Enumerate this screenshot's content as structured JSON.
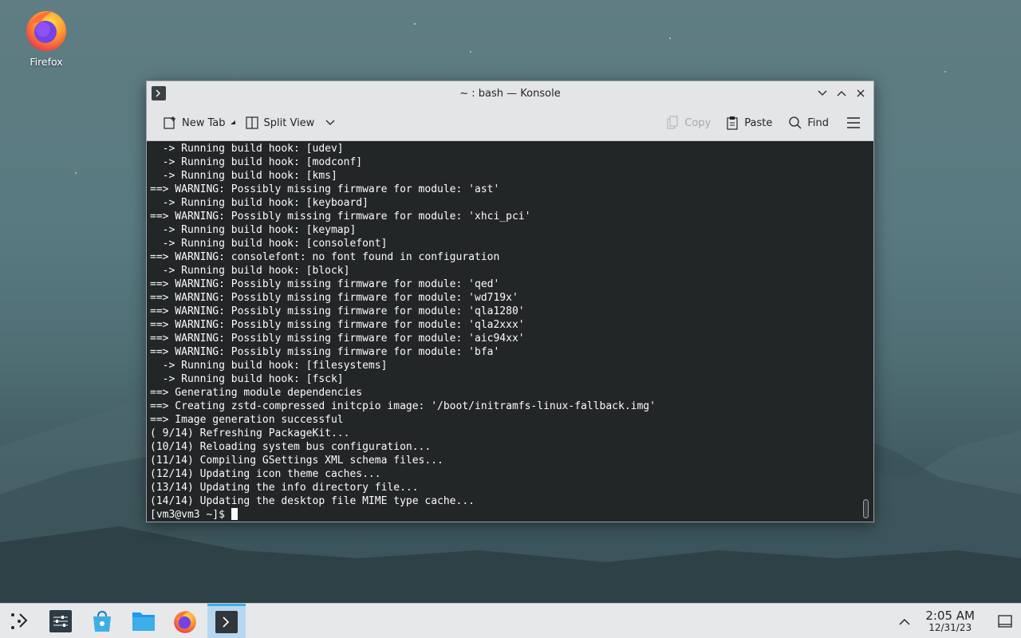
{
  "desktop": {
    "icons": [
      {
        "label": "Firefox",
        "icon": "firefox-icon"
      }
    ]
  },
  "window": {
    "title": "~ : bash — Konsole",
    "toolbar": {
      "new_tab": "New Tab",
      "split_view": "Split View",
      "copy": "Copy",
      "paste": "Paste",
      "find": "Find"
    }
  },
  "terminal": {
    "lines": [
      "  -> Running build hook: [udev]",
      "  -> Running build hook: [modconf]",
      "  -> Running build hook: [kms]",
      "==> WARNING: Possibly missing firmware for module: 'ast'",
      "  -> Running build hook: [keyboard]",
      "==> WARNING: Possibly missing firmware for module: 'xhci_pci'",
      "  -> Running build hook: [keymap]",
      "  -> Running build hook: [consolefont]",
      "==> WARNING: consolefont: no font found in configuration",
      "  -> Running build hook: [block]",
      "==> WARNING: Possibly missing firmware for module: 'qed'",
      "==> WARNING: Possibly missing firmware for module: 'wd719x'",
      "==> WARNING: Possibly missing firmware for module: 'qla1280'",
      "==> WARNING: Possibly missing firmware for module: 'qla2xxx'",
      "==> WARNING: Possibly missing firmware for module: 'aic94xx'",
      "==> WARNING: Possibly missing firmware for module: 'bfa'",
      "  -> Running build hook: [filesystems]",
      "  -> Running build hook: [fsck]",
      "==> Generating module dependencies",
      "==> Creating zstd-compressed initcpio image: '/boot/initramfs-linux-fallback.img'",
      "==> Image generation successful",
      "( 9/14) Refreshing PackageKit...",
      "(10/14) Reloading system bus configuration...",
      "(11/14) Compiling GSettings XML schema files...",
      "(12/14) Updating icon theme caches...",
      "(13/14) Updating the info directory file...",
      "(14/14) Updating the desktop file MIME type cache..."
    ],
    "prompt": "[vm3@vm3 ~]$ "
  },
  "taskbar": {
    "items": [
      "application-launcher-icon",
      "settings-icon",
      "discover-icon",
      "file-manager-icon",
      "firefox-icon",
      "konsole-icon"
    ],
    "active_item": "konsole-icon",
    "clock": {
      "time": "2:05 AM",
      "date": "12/31/23"
    }
  },
  "colors": {
    "terminal_bg": "#232627",
    "terminal_fg": "#fcfcfc",
    "active_task_highlight": "#3daee9"
  }
}
